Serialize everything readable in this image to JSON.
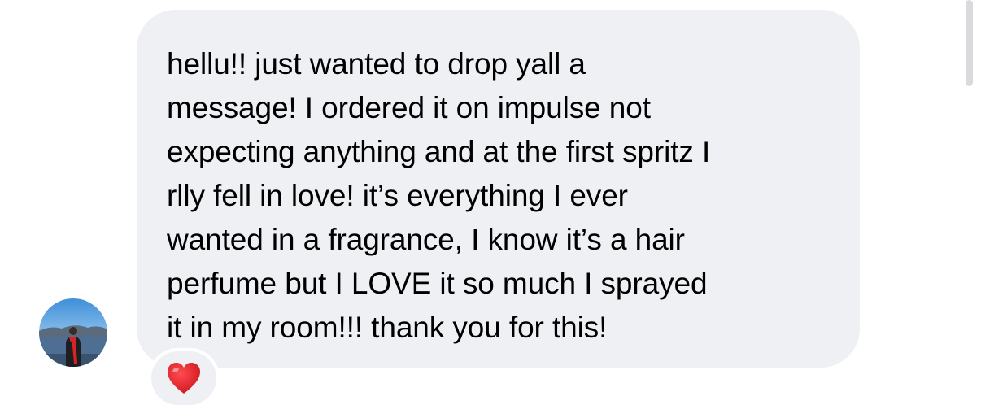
{
  "thread": {
    "message": {
      "text": "hellu!! just wanted to drop yall a\nmessage! I ordered it on impulse not\nexpecting anything and at the first spritz I\nrlly fell in love! it’s everything I ever\nwanted in a fragrance, I know it’s a hair\nperfume but I LOVE it so much I sprayed\nit in my room!!! thank you for this!"
    },
    "reaction": {
      "icon": "heart-icon",
      "color": "#e8262c"
    },
    "bubble_color": "#eff0f4"
  }
}
